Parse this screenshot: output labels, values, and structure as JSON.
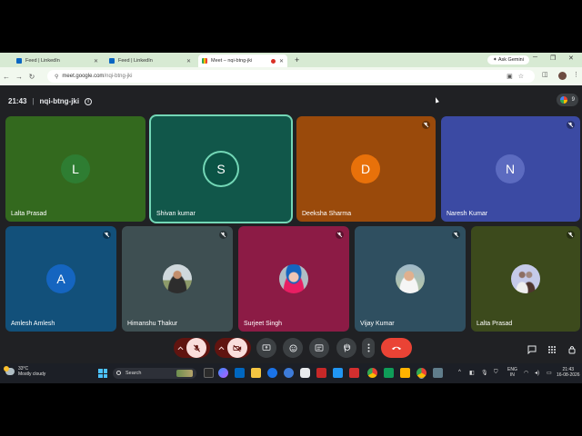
{
  "browser": {
    "tabs": [
      {
        "title": "Feed | LinkedIn",
        "favicon": "linkedin-icon",
        "active": false
      },
      {
        "title": "Feed | LinkedIn",
        "favicon": "linkedin-icon",
        "active": false
      },
      {
        "title": "Meet – nqi-btng-jki",
        "favicon": "meet-icon",
        "active": true
      }
    ],
    "ask_gemini_label": "Ask Gemini",
    "url_domain": "meet.google.com",
    "url_path": "/nqi-btng-jki"
  },
  "meet": {
    "time": "21:43",
    "meeting_code": "nqi-btng-jki",
    "participant_count": "9",
    "participants": [
      {
        "name": "Lalta Prasad",
        "initial": "L",
        "color": "#33691e",
        "avatar_color": "#2e7d32",
        "muted": false,
        "speaking": false,
        "has_photo": false
      },
      {
        "name": "Shivan kumar",
        "initial": "S",
        "color": "#11574a",
        "avatar_color": "#0b5345",
        "muted": false,
        "speaking": true,
        "has_photo": false
      },
      {
        "name": "Deeksha Sharma",
        "initial": "D",
        "color": "#9a4a0b",
        "avatar_color": "#e8710a",
        "muted": true,
        "speaking": false,
        "has_photo": false
      },
      {
        "name": "Naresh Kumar",
        "initial": "N",
        "color": "#3b4aa3",
        "avatar_color": "#5c6bc0",
        "muted": true,
        "speaking": false,
        "has_photo": false
      },
      {
        "name": "Amlesh Amlesh",
        "initial": "A",
        "color": "#12507a",
        "avatar_color": "#1565c0",
        "muted": true,
        "speaking": false,
        "has_photo": false
      },
      {
        "name": "Himanshu Thakur",
        "initial": "",
        "color": "#3e4f52",
        "muted": true,
        "speaking": false,
        "has_photo": true
      },
      {
        "name": "Surjeet Singh",
        "initial": "",
        "color": "#8c1b45",
        "muted": true,
        "speaking": false,
        "has_photo": true
      },
      {
        "name": "Vijay Kumar",
        "initial": "",
        "color": "#2f4f60",
        "muted": true,
        "speaking": false,
        "has_photo": true
      },
      {
        "name": "Lalta Prasad",
        "initial": "",
        "color": "#3c4a1c",
        "muted": true,
        "speaking": false,
        "has_photo": true
      }
    ]
  },
  "taskbar": {
    "temperature": "33°C",
    "weather": "Mostly cloudy",
    "search_placeholder": "Search",
    "lang_top": "ENG",
    "lang_bottom": "IN",
    "clock_time": "21:43",
    "clock_date": "16-08-2026"
  }
}
